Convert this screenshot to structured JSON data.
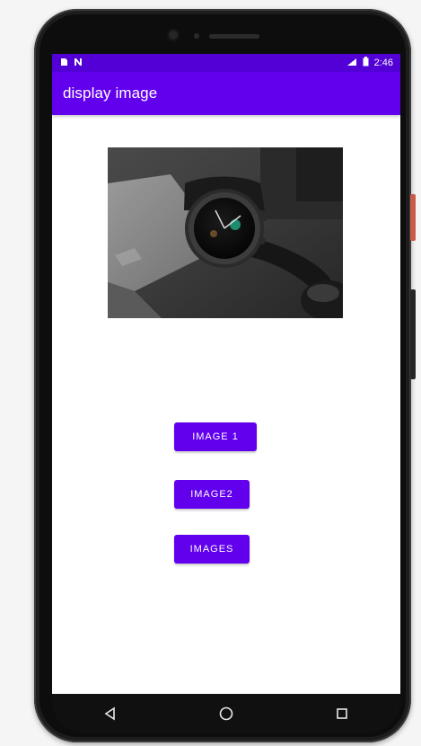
{
  "status_bar": {
    "left_icons": [
      "sim-card-icon",
      "n-icon"
    ],
    "time": "2:46",
    "right_icons": [
      "signal-icon",
      "battery-icon"
    ]
  },
  "app_bar": {
    "title": "display image"
  },
  "photo": {
    "subject": "watch-photo",
    "colors": {
      "background": "#3b3b3b",
      "watch_body": "#202020",
      "laptop": "#8a8a8a"
    }
  },
  "buttons": {
    "image1_label": "IMAGE 1",
    "image2_label": "IMAGE2",
    "image3_label": "IMAGES"
  },
  "nav_bar": {
    "back_icon": "back-triangle-icon",
    "home_icon": "home-circle-icon",
    "recents_icon": "recents-square-icon"
  },
  "colors": {
    "primary": "#6200ee",
    "status_bar": "#5200d6",
    "phone_body": "#1d1d1d"
  }
}
